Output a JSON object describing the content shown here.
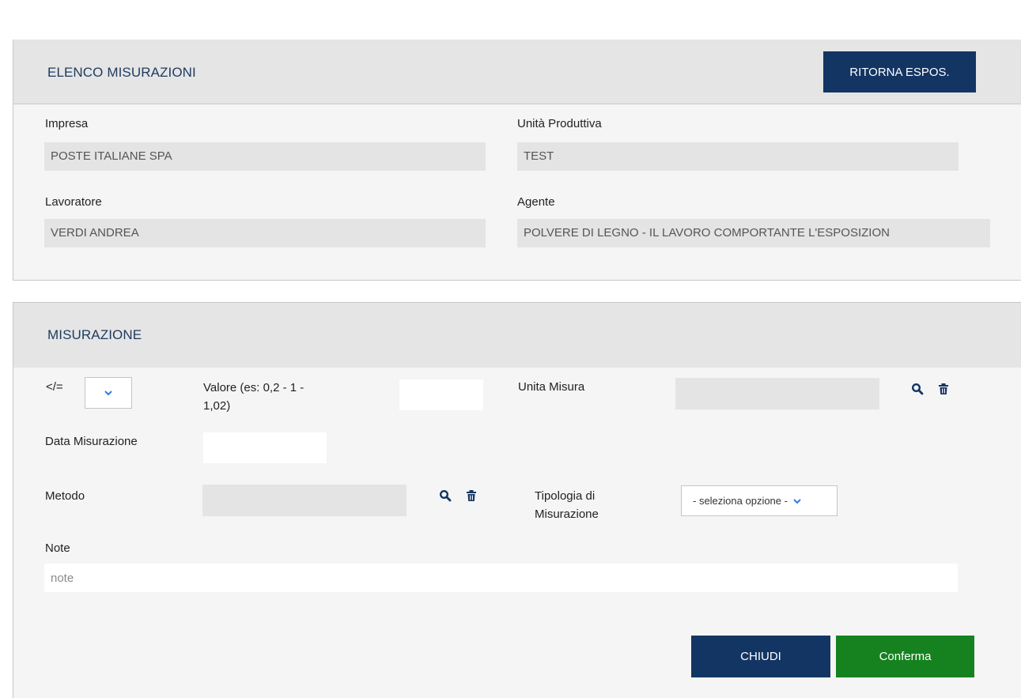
{
  "header": {
    "title": "ELENCO MISURAZIONI",
    "return_button": "RITORNA ESPOS."
  },
  "info": {
    "impresa_label": "Impresa",
    "impresa_value": "POSTE ITALIANE SPA",
    "unita_label": "Unità Produttiva",
    "unita_value": "TEST",
    "lavoratore_label": "Lavoratore",
    "lavoratore_value": "VERDI ANDREA",
    "agente_label": "Agente",
    "agente_value": "POLVERE DI LEGNO - IL LAVORO COMPORTANTE L'ESPOSIZION"
  },
  "misurazione": {
    "title": "MISURAZIONE",
    "operator_label": "</=",
    "valore_label_line1": "Valore (es: 0,2 - 1 -",
    "valore_label_line2": "1,02)",
    "unita_misura_label": "Unita Misura",
    "data_label": "Data Misurazione",
    "metodo_label": "Metodo",
    "tipologia_label_line1": "Tipologia di",
    "tipologia_label_line2": "Misurazione",
    "tipologia_selected": "- seleziona opzione -",
    "note_label": "Note",
    "note_placeholder": "note"
  },
  "actions": {
    "close_button": "CHIUDI",
    "confirm_button": "Conferma"
  },
  "colors": {
    "navy": "#133563",
    "green": "#15821f",
    "chevron": "#2a7de1"
  }
}
